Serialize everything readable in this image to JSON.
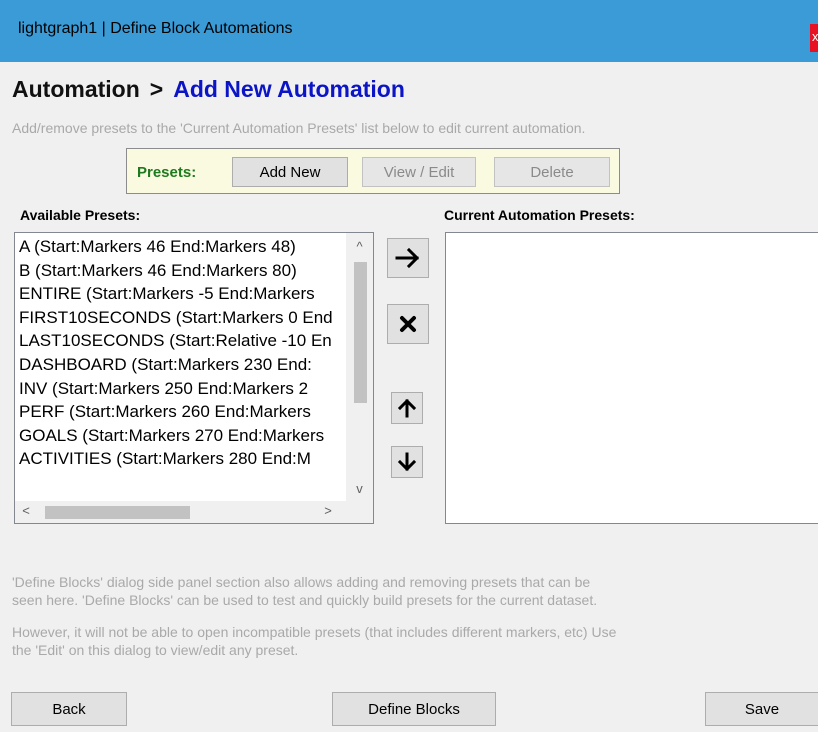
{
  "window": {
    "title": "lightgraph1 | Define Block Automations",
    "close_label": "x"
  },
  "header": {
    "breadcrumb_parent": "Automation",
    "breadcrumb_separator": ">",
    "breadcrumb_current": "Add New Automation",
    "subtitle": "Add/remove presets to the 'Current Automation Presets' list below to edit current automation."
  },
  "presets_toolbar": {
    "label": "Presets:",
    "add_new_label": "Add New",
    "view_edit_label": "View / Edit",
    "delete_label": "Delete"
  },
  "available_presets": {
    "label": "Available Presets:",
    "items": [
      "A (Start:Markers 46 End:Markers 48)",
      "B (Start:Markers 46 End:Markers 80)",
      "ENTIRE (Start:Markers -5 End:Markers",
      "FIRST10SECONDS (Start:Markers 0 End",
      "LAST10SECONDS (Start:Relative -10 En",
      "DASHBOARD (Start:Markers 230 End:",
      "INV (Start:Markers 250 End:Markers 2",
      "PERF (Start:Markers 260 End:Markers",
      "GOALS (Start:Markers 270 End:Markers",
      "ACTIVITIES (Start:Markers 280 End:M"
    ],
    "scroll_up": "^",
    "scroll_down": "v",
    "scroll_left": "<",
    "scroll_right": ">"
  },
  "side_buttons": {
    "add_icon": "arrow-right-icon",
    "remove_icon": "remove-x-icon",
    "move_up_icon": "arrow-up-icon",
    "move_down_icon": "arrow-down-icon"
  },
  "current_presets": {
    "label": "Current Automation Presets:",
    "items": []
  },
  "notes": {
    "line1": "'Define Blocks' dialog side panel section also allows adding and removing presets that can be",
    "line2": "seen here.  'Define Blocks' can be used to test and quickly build presets for the current dataset.",
    "line3": "However, it will not be able to open incompatible presets (that includes different markers, etc) Use",
    "line4": "the 'Edit' on this dialog to view/edit any preset."
  },
  "footer": {
    "back_label": "Back",
    "define_blocks_label": "Define Blocks",
    "save_label": "Save"
  },
  "colors": {
    "titlebar": "#3a9bd7",
    "heading_current": "#0c15c6",
    "presets_label": "#1e7a1e",
    "presets_bar_bg": "#fafae1",
    "hint_text": "#a9a9a9"
  }
}
